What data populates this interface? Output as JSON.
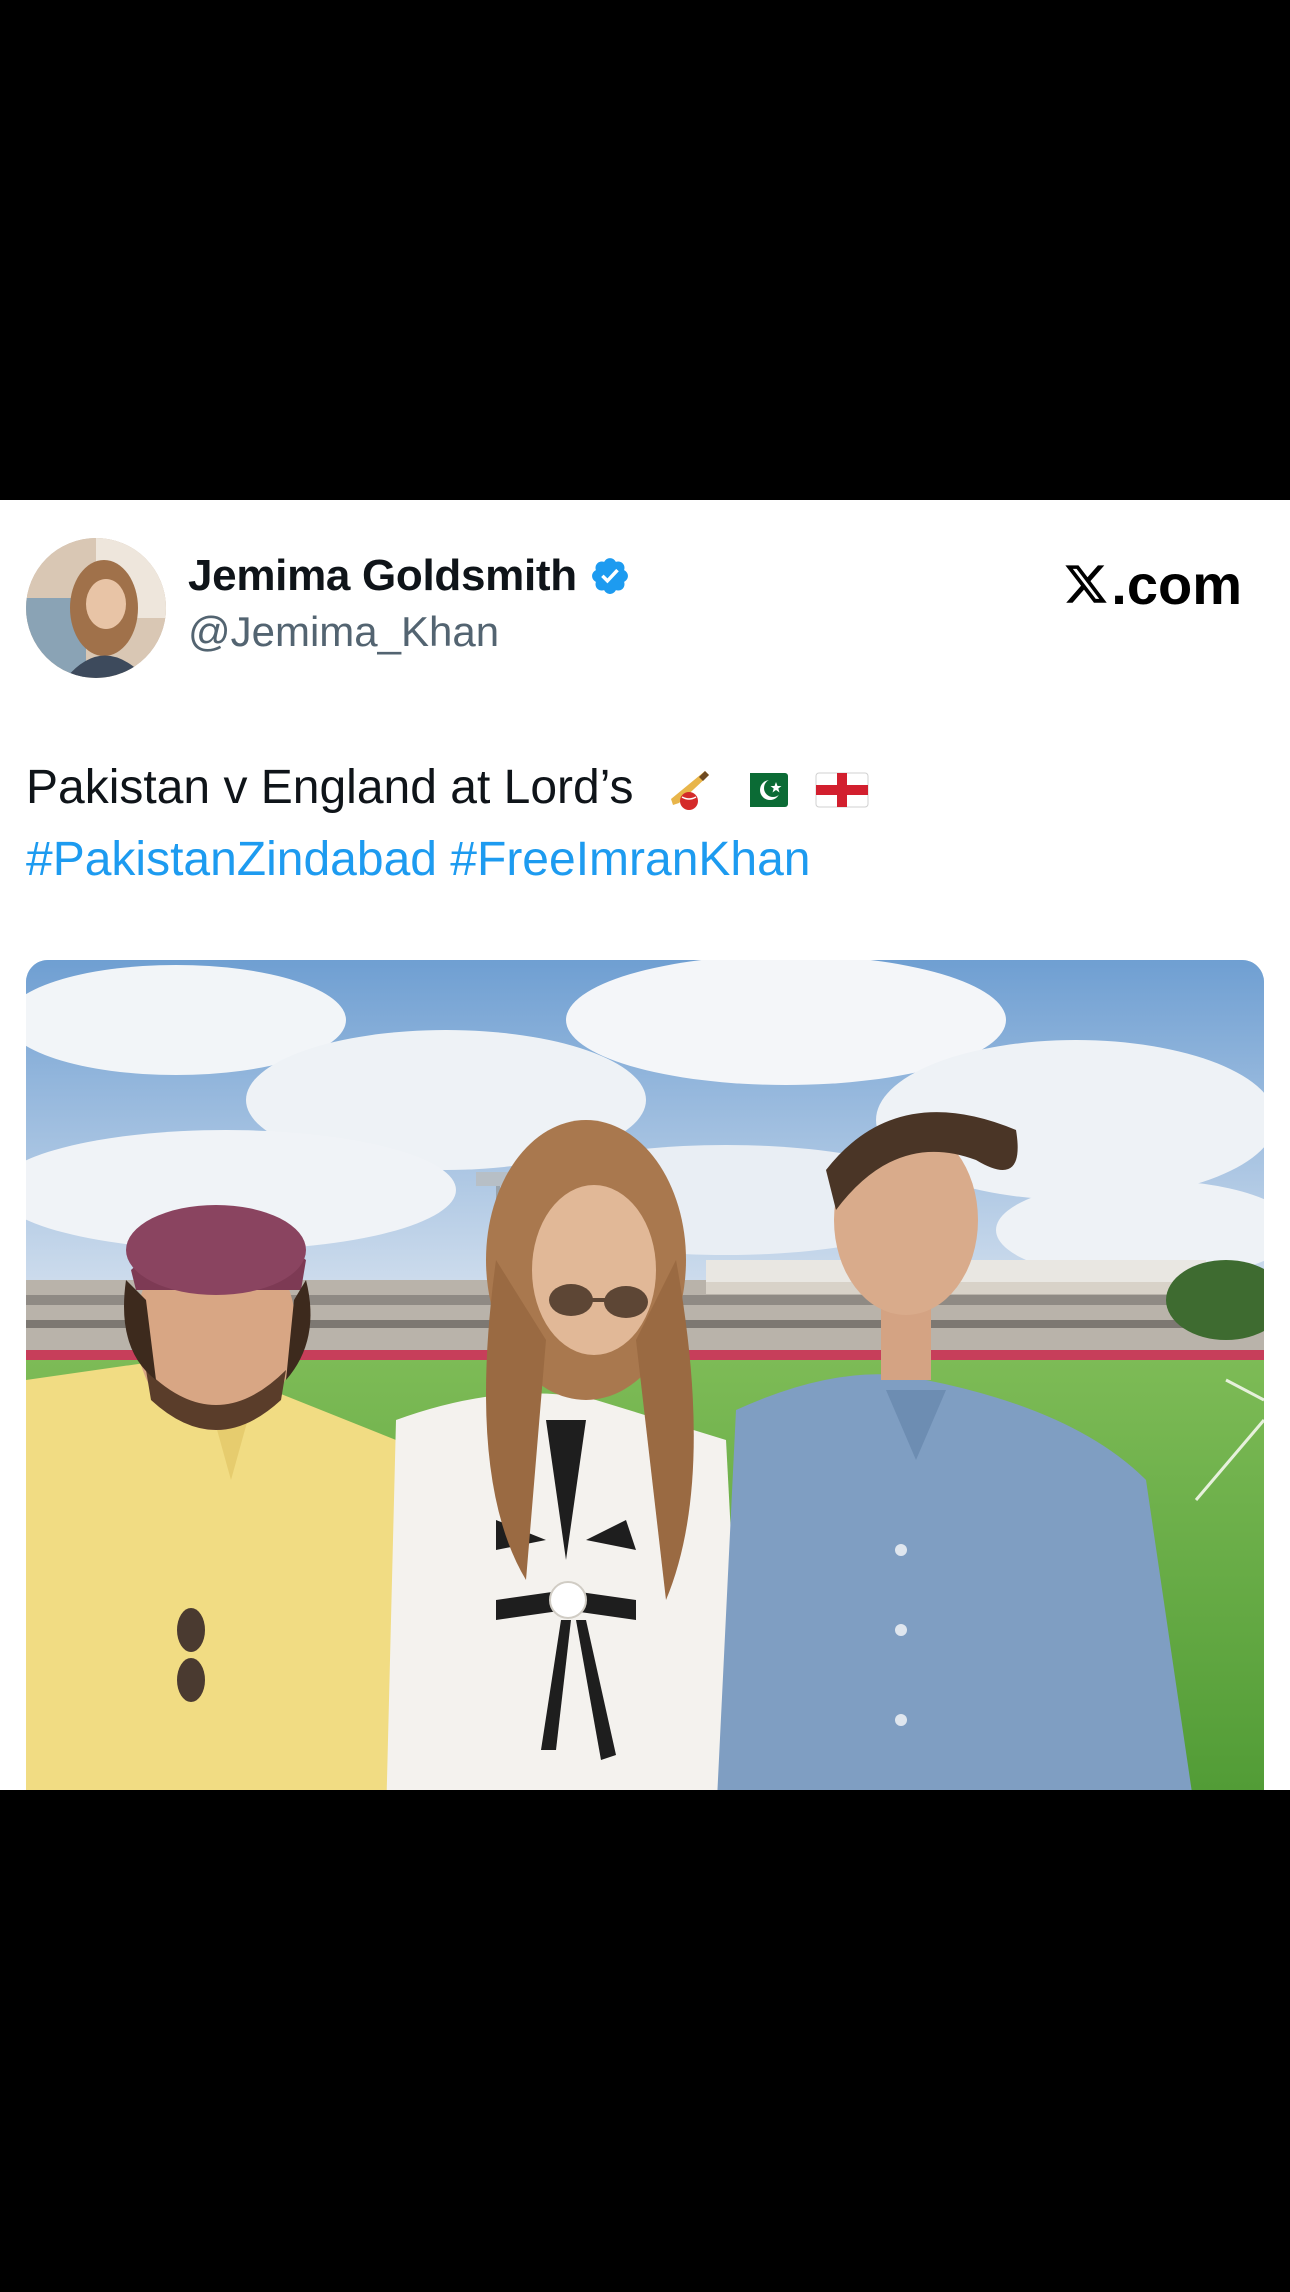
{
  "tweet": {
    "author": {
      "display_name": "Jemima Goldsmith",
      "handle": "@Jemima_Khan",
      "verified": true,
      "avatar_icon": "profile-photo"
    },
    "brand": {
      "logo_text": ".com",
      "logo_icon": "x-logo-icon"
    },
    "text": {
      "line1": "Pakistan v England at Lord’s",
      "emojis": [
        "cricket-bat-icon",
        "pakistan-flag-icon",
        "england-flag-icon"
      ],
      "hashtag1": "#PakistanZindabad",
      "hashtag2": "#FreeImranKhan"
    },
    "media": {
      "type": "photo",
      "description_icon": "tweet-photo"
    }
  },
  "colors": {
    "background": "#000000",
    "card": "#ffffff",
    "text_primary": "#0f1419",
    "text_secondary": "#536471",
    "link": "#1d9bf0",
    "verified": "#1d9bf0"
  }
}
